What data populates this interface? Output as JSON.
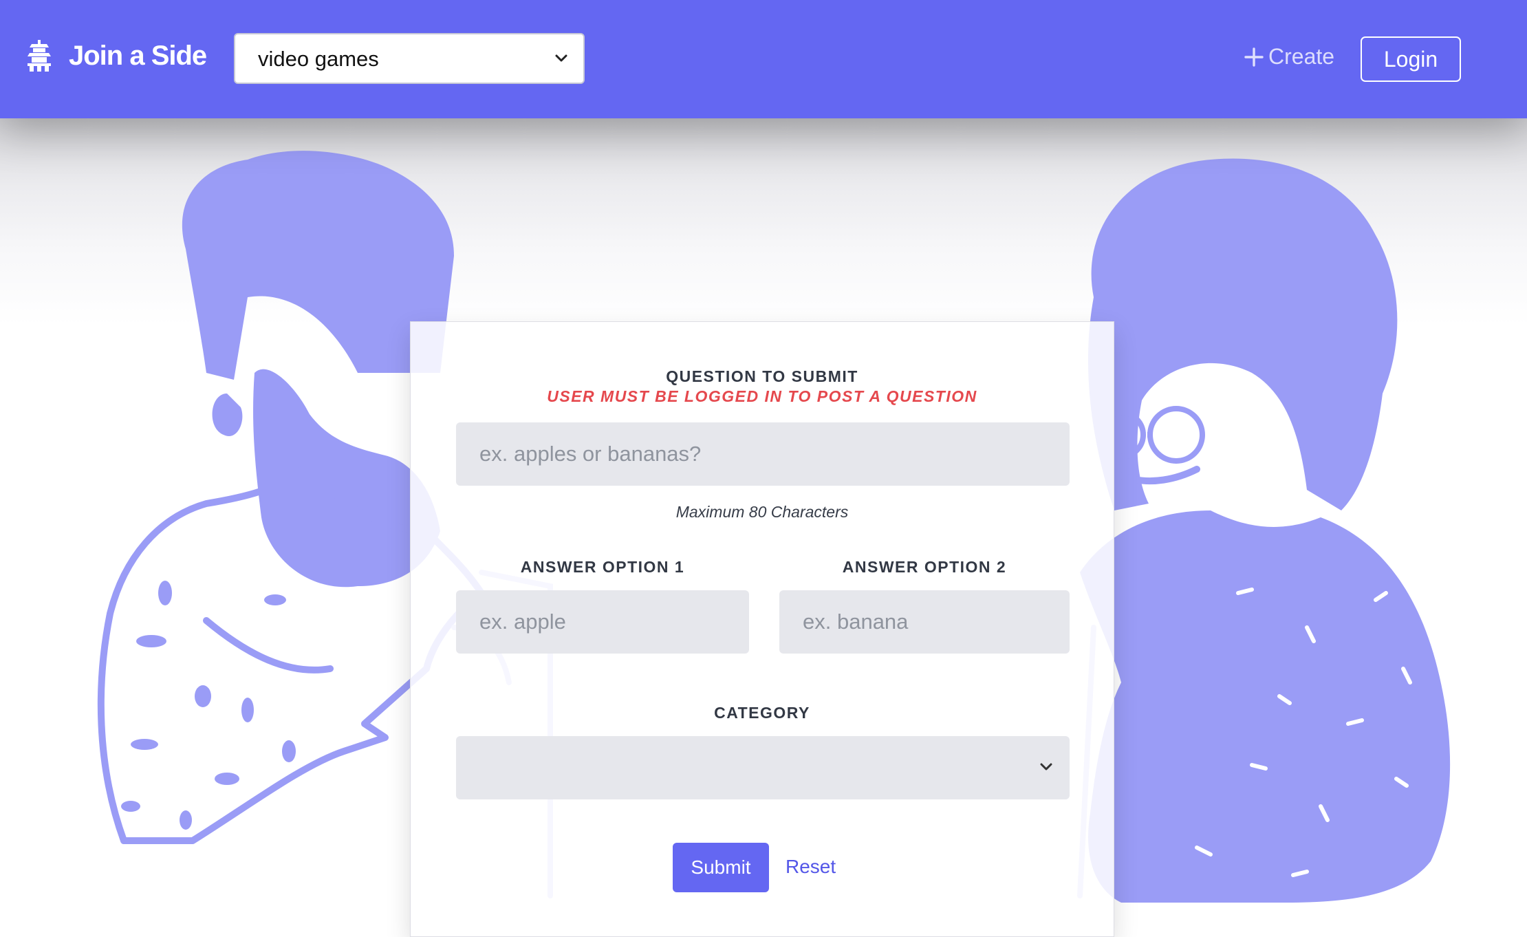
{
  "header": {
    "brand_icon": "pagoda-icon",
    "brand_title": "Join a Side",
    "category_select": {
      "value": "video games",
      "icon": "chevron-down-icon"
    },
    "create_icon": "plus-icon",
    "create_label": "Create",
    "login_label": "Login"
  },
  "form": {
    "question_label": "QUESTION TO SUBMIT",
    "login_warning": "USER MUST BE LOGGED IN TO POST A QUESTION",
    "question_placeholder": "ex. apples or bananas?",
    "question_hint": "Maximum 80 Characters",
    "option1_label": "ANSWER OPTION 1",
    "option1_placeholder": "ex. apple",
    "option2_label": "ANSWER OPTION 2",
    "option2_placeholder": "ex. banana",
    "category_label": "CATEGORY",
    "category_value": "",
    "submit_label": "Submit",
    "reset_label": "Reset"
  },
  "colors": {
    "primary": "#6467f2",
    "illustration": "#9a9cf6",
    "warning": "#e5484d",
    "input_bg": "#e5e6eb"
  }
}
